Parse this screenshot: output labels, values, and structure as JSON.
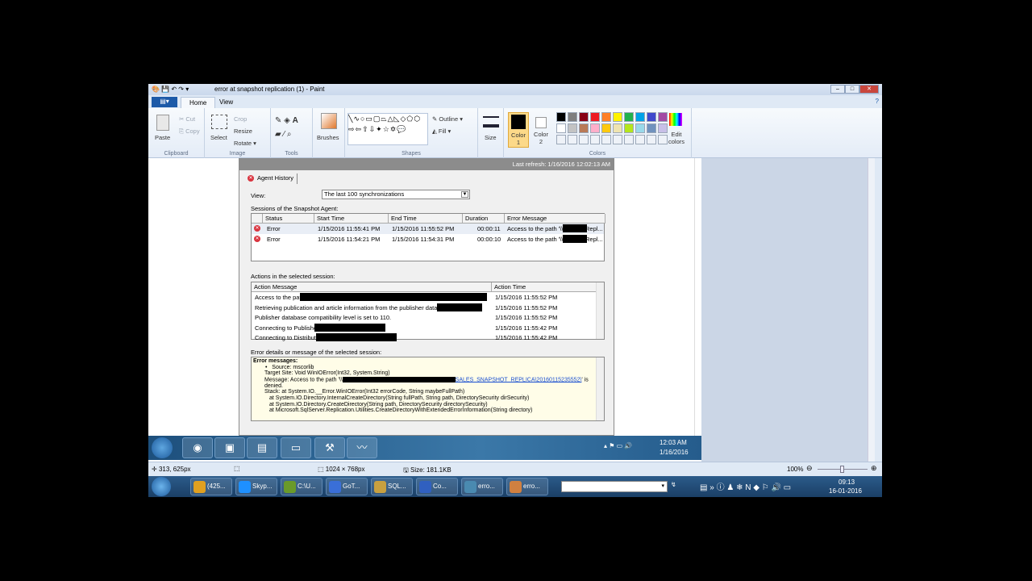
{
  "window": {
    "title": "error at snapshot replication (1) - Paint",
    "min": "–",
    "max": "□",
    "close": "✕"
  },
  "tabs": {
    "file": "▤▾",
    "home": "Home",
    "view": "View"
  },
  "ribbon": {
    "clipboard": {
      "label": "Clipboard",
      "paste": "Paste",
      "cut": "Cut",
      "copy": "Copy"
    },
    "image": {
      "label": "Image",
      "select": "Select",
      "crop": "Crop",
      "resize": "Resize",
      "rotate": "Rotate ▾"
    },
    "tools": {
      "label": "Tools"
    },
    "brushes": {
      "label": "Brushes"
    },
    "shapes": {
      "label": "Shapes",
      "outline": "Outline ▾",
      "fill": "Fill ▾",
      "glyphs": "╲∿○▭▢⏢△◺◇⬠⬡⇨⇦⇧⇩✦☆✡💬"
    },
    "size": {
      "label": "Size"
    },
    "colors": {
      "label": "Colors",
      "color1": "Color 1",
      "color2": "Color 2",
      "edit": "Edit colors",
      "palette_row1": [
        "#000000",
        "#7f7f7f",
        "#880015",
        "#ed1c24",
        "#ff7f27",
        "#fff200",
        "#22b14c",
        "#00a2e8",
        "#3f48cc",
        "#a349a4"
      ],
      "palette_row2": [
        "#ffffff",
        "#c3c3c3",
        "#b97a57",
        "#ffaec9",
        "#ffc90e",
        "#efe4b0",
        "#b5e61d",
        "#99d9ea",
        "#7092be",
        "#c8bfe7"
      ]
    }
  },
  "dialog": {
    "last_refresh": "Last refresh: 1/16/2016 12:02:13 AM",
    "tab": "Agent History",
    "view_label": "View:",
    "view_value": "The last 100 synchronizations",
    "sessions_label": "Sessions of the Snapshot Agent:",
    "sessions_headers": [
      "Status",
      "Start Time",
      "End Time",
      "Duration",
      "Error Message"
    ],
    "sessions": [
      {
        "status": "Error",
        "start": "1/15/2016 11:55:41 PM",
        "end": "1/15/2016 11:55:52 PM",
        "duration": "00:00:11",
        "msg": "Access to the path '\\\\",
        "msg_tail": "Repl..."
      },
      {
        "status": "Error",
        "start": "1/15/2016 11:54:21 PM",
        "end": "1/15/2016 11:54:31 PM",
        "duration": "00:00:10",
        "msg": "Access to the path '\\\\",
        "msg_tail": "Repl..."
      }
    ],
    "actions_label": "Actions in the selected session:",
    "actions_headers": [
      "Action Message",
      "Action Time"
    ],
    "actions": [
      {
        "msg": "Access to the path",
        "time": "1/15/2016 11:55:52 PM"
      },
      {
        "msg": "Retrieving publication and article information from the publisher database",
        "time": "1/15/2016 11:55:52 PM"
      },
      {
        "msg": "Publisher database compatibility level is set to 110.",
        "time": "1/15/2016 11:55:52 PM"
      },
      {
        "msg": "Connecting to Publisher",
        "time": "1/15/2016 11:55:42 PM"
      },
      {
        "msg": "Connecting to Distributor",
        "time": "1/15/2016 11:55:42 PM"
      }
    ],
    "details_label": "Error details or message of the selected session:",
    "details": {
      "heading": "Error messages:",
      "source": "Source: mscorlib",
      "target": "Target Site: Void WinIOError(Int32, System.String)",
      "message": "Message: Access to the path '\\\\",
      "message_link": "SALES_SNAPSHOT_REPLICA\\20160115235552\\",
      "message_end": "' is",
      "denied": "denied.",
      "stack1": "Stack:    at System.IO.__Error.WinIOError(Int32 errorCode, String maybeFullPath)",
      "stack2": "at System.IO.Directory.InternalCreateDirectory(String fullPath, String path, DirectorySecurity dirSecurity)",
      "stack3": "at System.IO.Directory.CreateDirectory(String path, DirectorySecurity directorySecurity)",
      "stack4": "at Microsoft.SqlServer.Replication.Utilities.CreateDirectoryWithExtendedErrorInformation(String directory)"
    }
  },
  "inner_taskbar": {
    "time": "12:03 AM",
    "date": "1/16/2016"
  },
  "statusbar": {
    "cursor": "313, 625px",
    "dimensions": "1024 × 768px",
    "size": "Size: 181.1KB",
    "zoom": "100%"
  },
  "taskbar": {
    "items": [
      "(425...",
      "Skyp...",
      "C:\\U...",
      "GoT...",
      "SQL...",
      "Co...",
      "erro...",
      "erro..."
    ],
    "time": "09:13",
    "date": "16-01-2016"
  }
}
